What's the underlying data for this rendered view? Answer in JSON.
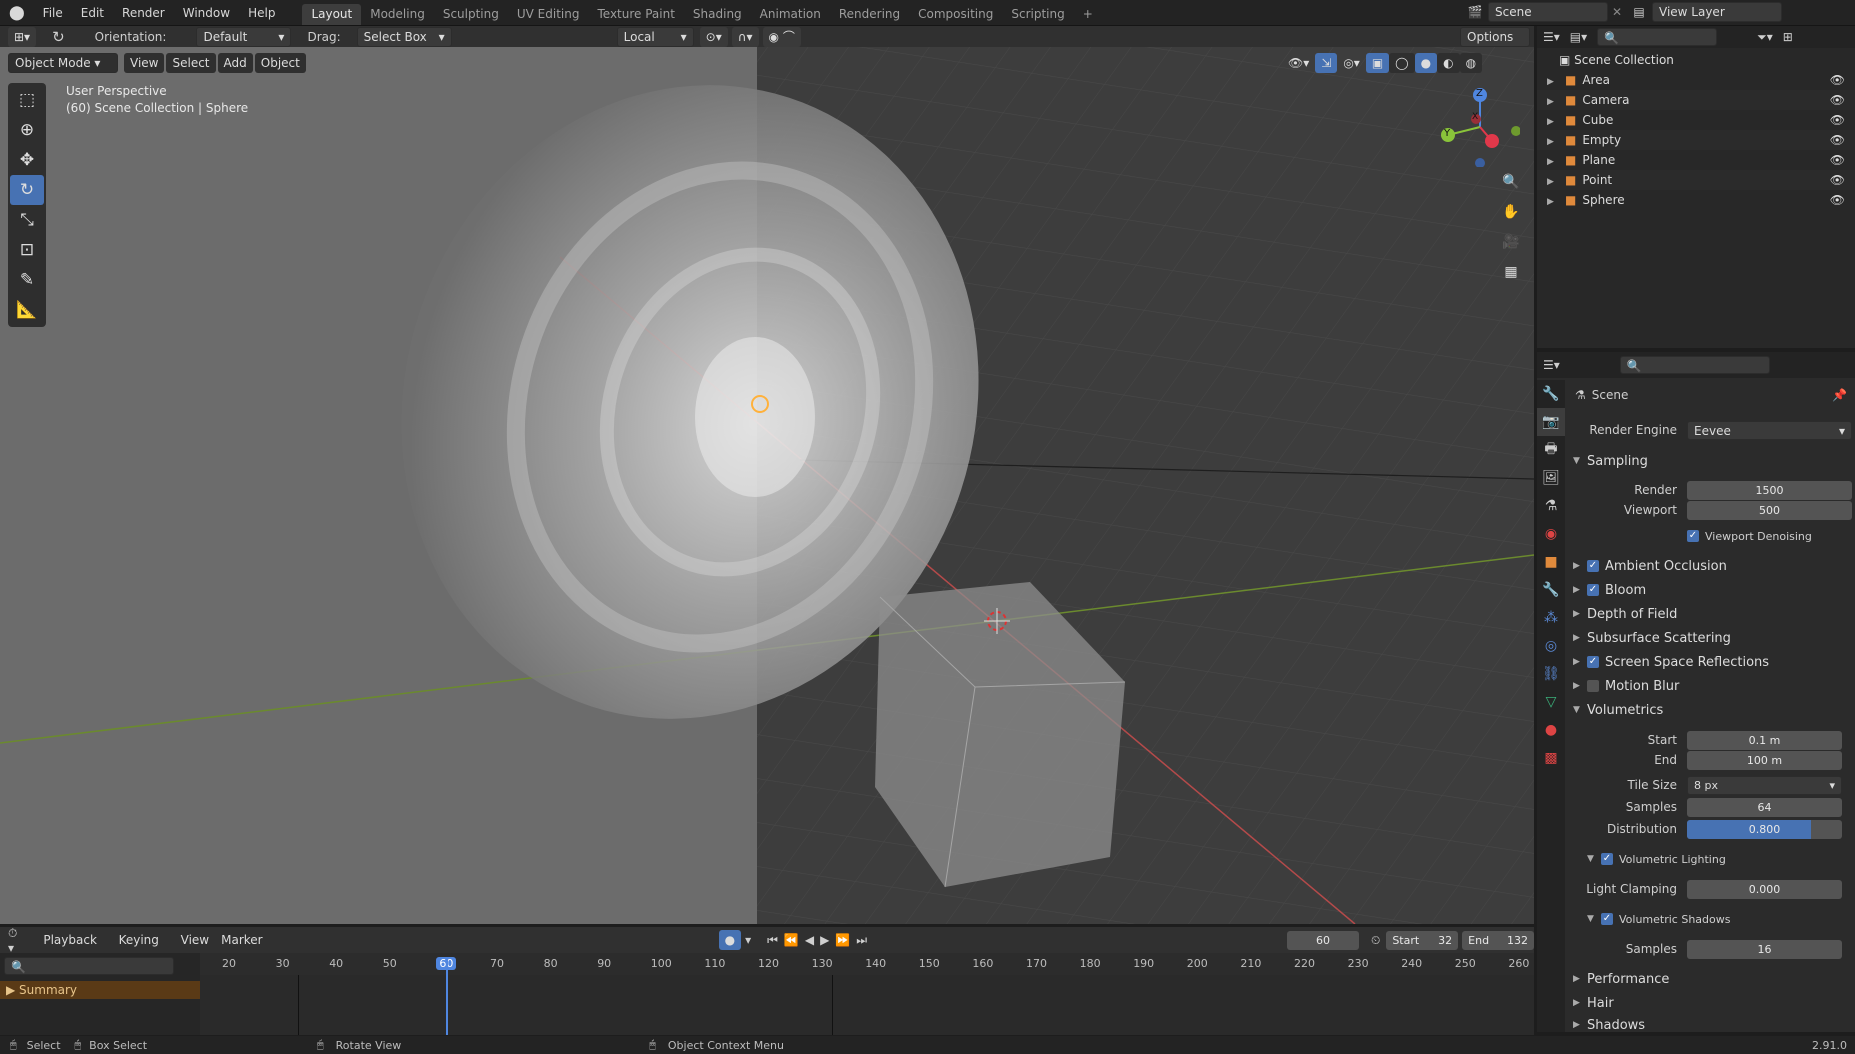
{
  "app": {
    "version": "2.91.0"
  },
  "menu": [
    "File",
    "Edit",
    "Render",
    "Window",
    "Help"
  ],
  "workspaces": [
    {
      "label": "Layout",
      "active": true
    },
    {
      "label": "Modeling"
    },
    {
      "label": "Sculpting"
    },
    {
      "label": "UV Editing"
    },
    {
      "label": "Texture Paint"
    },
    {
      "label": "Shading"
    },
    {
      "label": "Animation"
    },
    {
      "label": "Rendering"
    },
    {
      "label": "Compositing"
    },
    {
      "label": "Scripting"
    }
  ],
  "scene_field": "Scene",
  "view_layer_field": "View Layer",
  "tool_header": {
    "orientation_label": "Orientation:",
    "orientation_value": "Default",
    "drag_label": "Drag:",
    "drag_value": "Select Box",
    "pivot_value": "Local",
    "options_label": "Options"
  },
  "viewport_header": {
    "mode": "Object Mode",
    "menus": [
      "View",
      "Select",
      "Add",
      "Object"
    ]
  },
  "viewport": {
    "perspective": "User Perspective",
    "context": "(60) Scene Collection | Sphere",
    "gizmo": {
      "x": "X",
      "y": "Y",
      "z": "Z"
    }
  },
  "outliner": {
    "root": "Scene Collection",
    "items": [
      {
        "name": "Area",
        "icon": "light-icon",
        "color": "#e08a3c"
      },
      {
        "name": "Camera",
        "icon": "camera-icon",
        "color": "#e08a3c"
      },
      {
        "name": "Cube",
        "icon": "mesh-icon",
        "color": "#e08a3c"
      },
      {
        "name": "Empty",
        "icon": "empty-icon",
        "color": "#e08a3c"
      },
      {
        "name": "Plane",
        "icon": "mesh-icon",
        "color": "#e08a3c"
      },
      {
        "name": "Point",
        "icon": "light-icon",
        "color": "#e08a3c"
      },
      {
        "name": "Sphere",
        "icon": "mesh-icon",
        "color": "#e08a3c"
      }
    ]
  },
  "properties": {
    "context": "Scene",
    "render_engine_label": "Render Engine",
    "render_engine_value": "Eevee",
    "sampling": {
      "title": "Sampling",
      "render_label": "Render",
      "render_value": "1500",
      "viewport_label": "Viewport",
      "viewport_value": "500",
      "denoise_label": "Viewport Denoising"
    },
    "panels": [
      {
        "label": "Ambient Occlusion",
        "checkbox": true,
        "checked": true
      },
      {
        "label": "Bloom",
        "checkbox": true,
        "checked": true
      },
      {
        "label": "Depth of Field",
        "checkbox": false
      },
      {
        "label": "Subsurface Scattering",
        "checkbox": false
      },
      {
        "label": "Screen Space Reflections",
        "checkbox": true,
        "checked": true
      },
      {
        "label": "Motion Blur",
        "checkbox": true,
        "checked": false
      }
    ],
    "volumetrics": {
      "title": "Volumetrics",
      "start_label": "Start",
      "start_value": "0.1 m",
      "end_label": "End",
      "end_value": "100 m",
      "tile_label": "Tile Size",
      "tile_value": "8 px",
      "samples_label": "Samples",
      "samples_value": "64",
      "distribution_label": "Distribution",
      "distribution_value": "0.800",
      "distribution_fraction": 0.8,
      "lighting_label": "Volumetric Lighting",
      "clamping_label": "Light Clamping",
      "clamping_value": "0.000",
      "shadows_label": "Volumetric Shadows",
      "shadow_samples_label": "Samples",
      "shadow_samples_value": "16"
    },
    "more_panels": [
      "Performance",
      "Hair",
      "Shadows"
    ]
  },
  "timeline": {
    "menus": [
      "Playback",
      "Keying",
      "View",
      "Marker"
    ],
    "current_frame": "60",
    "start_label": "Start",
    "start_value": "32",
    "end_label": "End",
    "end_value": "132",
    "ticks": [
      "20",
      "30",
      "40",
      "50",
      "60",
      "70",
      "80",
      "90",
      "100",
      "110",
      "120",
      "130",
      "140",
      "150",
      "160",
      "170",
      "180",
      "190",
      "200",
      "210",
      "220",
      "230",
      "240",
      "250",
      "260"
    ],
    "summary_label": "Summary"
  },
  "statusbar": {
    "select": "Select",
    "box_select": "Box Select",
    "rotate": "Rotate View",
    "context_menu": "Object Context Menu"
  }
}
